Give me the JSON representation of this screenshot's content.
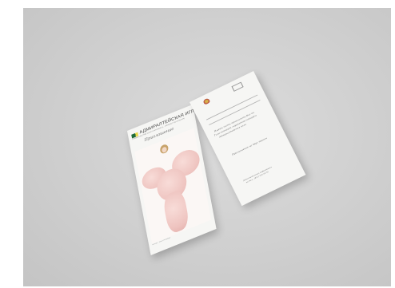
{
  "front_card": {
    "brand": "АДМИРАЛТЕЙСКАЯ ИГЛА",
    "subtitle": "ПРАВИТЕЛЬСТВО САНКТ-ПЕТЕРБУРГА · КОМИТЕТ ПО КУЛЬТУРЕ",
    "script_title": "Приглашение",
    "fine_print": "Конкурс · Санкт-Петербург"
  },
  "back_card": {
    "script_line_1": "Имеем честь пригласить Вас на",
    "script_line_2": "Гала-концерт лауреатов конкурса",
    "script_line_3": "Адмиралтейская игла",
    "entry_note": "Приглашение на двух персон",
    "footer_1": "Дополнительная информация",
    "footer_2": "по тел.: (812) 555-55-55"
  }
}
